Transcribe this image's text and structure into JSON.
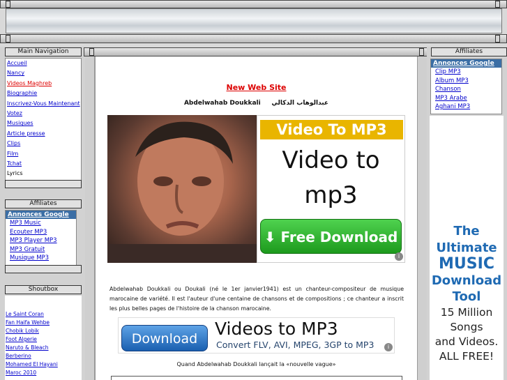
{
  "main_navigation": {
    "title": "Main Navigation",
    "items": [
      {
        "label": "Accueil",
        "style": "link"
      },
      {
        "label": "Nancy",
        "style": "link"
      },
      {
        "label": "Videos Maghreb",
        "style": "current"
      },
      {
        "label": "Biographie",
        "style": "link"
      },
      {
        "label": "Inscrivez-Vous Maintenant",
        "style": "link"
      },
      {
        "label": "Votez",
        "style": "link"
      },
      {
        "label": "Musiques",
        "style": "link"
      },
      {
        "label": "Article presse",
        "style": "link"
      },
      {
        "label": "Clips",
        "style": "link"
      },
      {
        "label": "Film",
        "style": "link"
      },
      {
        "label": "Tchat",
        "style": "link"
      },
      {
        "label": "Lyrics",
        "style": "plain"
      }
    ]
  },
  "left_affiliates": {
    "title": "Affiliates",
    "ads_title": "Annonces Google",
    "links": [
      "MP3 Music",
      "Ecouter MP3",
      "MP3 Player MP3",
      "MP3 Gratuit",
      "Musique MP3"
    ]
  },
  "shoutbox": {
    "title": "Shoutbox",
    "links": [
      "Le Saint Coran",
      "Fan Haifa Wehbe",
      "Chobik Lobik",
      "Foot Algerie",
      "Naruto & Bleach",
      "Berberino",
      "Mohamed El Hayani",
      "Maroc 2010"
    ]
  },
  "right_affiliates": {
    "title": "Affiliates",
    "ads_title": "Annonces Google",
    "links": [
      "Clip MP3",
      "Album MP3",
      "Chanson",
      "MP3 Arabe",
      "Aghani MP3"
    ]
  },
  "content": {
    "new_site_link": "New Web Site",
    "artist_name_latin": "Abdelwahab Doukkali",
    "artist_name_arabic": "عبدالوهاب الدكالي",
    "description": "Abdelwahab Doukkali ou Doukali (né le 1er janvier1941) est un chanteur-compositeur de musique marocaine de variété. Il est l'auteur d'une centaine de chansons et de compositions ; ce chanteur a inscrit les plus belles pages de l'histoire de la chanson marocaine.",
    "section_heading": "Quand Abdelwahab Doukkali lançait la «nouvelle vague»"
  },
  "ad_video_to_mp3": {
    "top_label": "Video To MP3",
    "line1": "Video to",
    "line2": "mp3",
    "button": "Free Download"
  },
  "ad_videos_to_mp3_banner": {
    "button": "Download",
    "headline": "Videos to MP3",
    "subline": "Convert FLV, AVI, MPEG, 3GP to MP3"
  },
  "ad_music_tool": {
    "line1": "The",
    "line2": "Ultimate",
    "line3": "MUSIC",
    "line4": "Download",
    "line5": "Tool",
    "line6": "15 Million",
    "line7": "Songs",
    "line8": "and Videos.",
    "line9": "ALL FREE!"
  }
}
